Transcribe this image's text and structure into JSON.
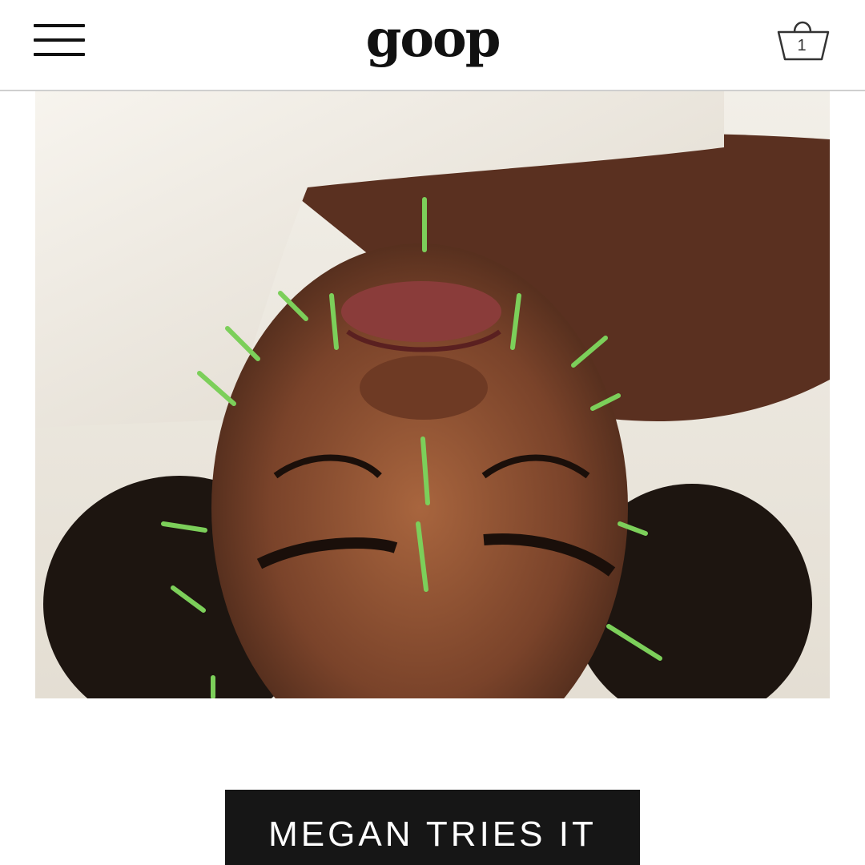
{
  "header": {
    "logo_text": "goop",
    "cart_count": "1",
    "menu_icon": "hamburger-menu-icon",
    "cart_icon": "shopping-bag-icon"
  },
  "hero": {
    "subject": "acupuncture-facial-photo"
  },
  "cta": {
    "label": "MEGAN TRIES IT"
  },
  "colors": {
    "text": "#111111",
    "cta_background": "#161616",
    "cta_text": "#ffffff",
    "divider": "#cfcfcf",
    "needle": "#7ccf5a"
  }
}
